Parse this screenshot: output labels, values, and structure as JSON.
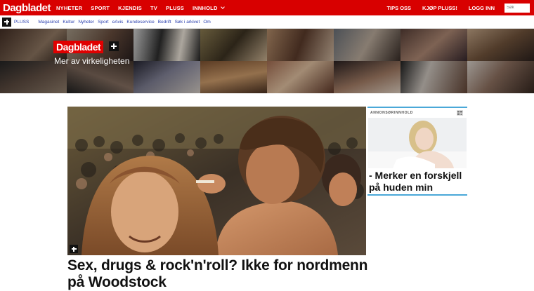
{
  "topnav": {
    "logo": "Dagbladet",
    "links": [
      "NYHETER",
      "SPORT",
      "KJENDIS",
      "TV",
      "PLUSS",
      "INNHOLD"
    ],
    "right_links": [
      "TIPS OSS",
      "KJØP PLUSS!",
      "LOGG INN"
    ],
    "search_placeholder": "Søk",
    "color": "#d80000"
  },
  "subnav": {
    "pluss_label": "PLUSS",
    "links": [
      "Magasinet",
      "Kultur",
      "Nyheter",
      "Sport",
      "eAvis",
      "Kundeservice",
      "Bedrift",
      "Søk i arkivet",
      "Om"
    ],
    "link_color": "#2a3fae"
  },
  "banner": {
    "brand": "Dagbladet",
    "tagline": "Mer av virkeligheten"
  },
  "article": {
    "headline": "Sex, drugs & rock'n'roll? Ikke for nordmenn på Woodstock"
  },
  "ad": {
    "label": "ANNONSØRINNHOLD",
    "title": "- Merker en forskjell på huden min",
    "border_color": "#4aa8d8"
  }
}
